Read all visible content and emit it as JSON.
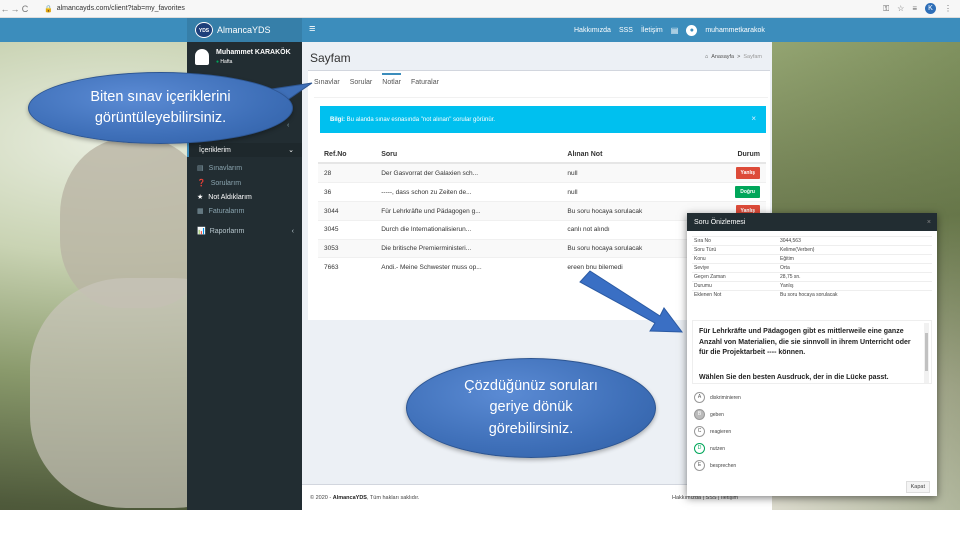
{
  "browser": {
    "back": "←",
    "forward": "→",
    "reload": "C",
    "url": "almancayds.com/client?tab=my_favorites",
    "profile": "K"
  },
  "header": {
    "brand": "AlmancaYDS",
    "logo_text": "YDS",
    "menu_icon": "≡",
    "links": [
      "Hakkımızda",
      "SSS",
      "İletişim"
    ],
    "username": "muhammetkarakok"
  },
  "sidebar": {
    "user_name": "Muhammet KARAKÖK",
    "user_status": "Hafta",
    "icerikler_label": "İçeriklerim",
    "sub_items": [
      {
        "label": "Sınavlarım",
        "icon": "file-icon"
      },
      {
        "label": "Sorularım",
        "icon": "question-icon"
      },
      {
        "label": "Not Aldıklarım",
        "icon": "star-icon"
      },
      {
        "label": "Faturalarım",
        "icon": "invoice-icon"
      }
    ],
    "raporlarim_label": "Raporlarım"
  },
  "content": {
    "page_title": "Sayfam",
    "breadcrumb_home": "Anasayfa",
    "breadcrumb_sep": ">",
    "breadcrumb_current": "Sayfam",
    "tabs": [
      "Sınavlar",
      "Sorular",
      "Notlar",
      "Faturalar"
    ],
    "active_tab": "Notlar",
    "alert_bold": "Bilgi:",
    "alert_text": "Bu alanda sınav esnasında \"not alınan\" sorular görünür.",
    "alert_close": "×",
    "table_headers": [
      "Ref.No",
      "Soru",
      "Alınan Not",
      "Durum"
    ],
    "rows": [
      {
        "ref": "28",
        "soru": "Der Gasvorrat der Galaxien sch...",
        "not": "null",
        "durum": "Yanlış",
        "status": "yanlis"
      },
      {
        "ref": "36",
        "soru": "-----, dass schon zu Zeiten de...",
        "not": "null",
        "durum": "Doğru",
        "status": "dogru"
      },
      {
        "ref": "3044",
        "soru": "Für Lehrkräfte und Pädagogen g...",
        "not": "Bu soru hocaya sorulacak",
        "durum": "Yanlış",
        "status": "yanlis"
      },
      {
        "ref": "3045",
        "soru": "Durch die Internationalisierun...",
        "not": "canlı not alındı",
        "durum": "",
        "status": ""
      },
      {
        "ref": "3053",
        "soru": "Die britische Premierministeri...",
        "not": "Bu soru hocaya sorulacak",
        "durum": "",
        "status": ""
      },
      {
        "ref": "7663",
        "soru": "Andi.- Meine Schwester muss op...",
        "not": "ereen bnu bilemedi",
        "durum": "",
        "status": ""
      }
    ]
  },
  "footer": {
    "copyright": "© 2020 -",
    "brand": "AlmancaYDS",
    "rights": ", Tüm hakları saklıdır.",
    "links": "Hakkımızda | SSS | İletişim"
  },
  "modal": {
    "title": "Soru Önizlemesi",
    "close": "×",
    "details": [
      {
        "k": "Sıra No",
        "v": "3044,563"
      },
      {
        "k": "Soru Türü",
        "v": "Kelime(Verben)"
      },
      {
        "k": "Konu",
        "v": "Eğitim"
      },
      {
        "k": "Seviye",
        "v": "Orta"
      },
      {
        "k": "Geçen Zaman",
        "v": "28,75 sn."
      },
      {
        "k": "Durumu",
        "v": "Yanlış"
      },
      {
        "k": "Eklenen Not",
        "v": "Bu soru hocaya sorulacak"
      }
    ],
    "question_text": "Für Lehrkräfte und Pädagogen gibt es mittlerweile eine ganze Anzahl von Materialien, die sie sinnvoll in ihrem Unterricht oder für die Projektarbeit ---- können.",
    "question_prompt": "Wählen Sie den besten Ausdruck, der in die Lücke passt.",
    "options": [
      {
        "letter": "A",
        "text": "diskriminieren",
        "state": "none"
      },
      {
        "letter": "B",
        "text": "geben",
        "state": "selected"
      },
      {
        "letter": "C",
        "text": "reagieren",
        "state": "none"
      },
      {
        "letter": "D",
        "text": "nutzen",
        "state": "correct"
      },
      {
        "letter": "E",
        "text": "besprechen",
        "state": "none"
      }
    ],
    "close_button": "Kapat"
  },
  "callouts": {
    "top": "Biten sınav içeriklerini görüntüleyebilirsiniz.",
    "bottom": "Çözdüğünüz soruları geriye dönük görebilirsiniz."
  },
  "colors": {
    "header": "#3c8dbc",
    "sidebar": "#222d32",
    "alert": "#00c0ef",
    "danger": "#dd4b39",
    "success": "#00a65a",
    "callout": "#3e6fb8"
  }
}
